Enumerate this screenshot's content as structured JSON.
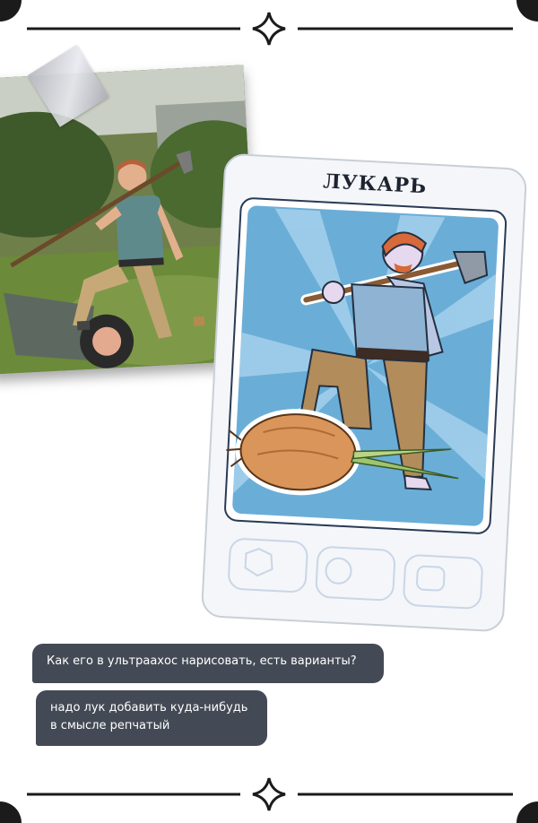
{
  "card": {
    "title": "ЛУКАРЬ"
  },
  "chat": {
    "messages": [
      {
        "lines": [
          "Как его в ультраахос нарисовать, есть варианты?"
        ]
      },
      {
        "lines": [
          "надо лук добавить куда-нибудь",
          "в смысле репчатый"
        ]
      }
    ]
  },
  "colors": {
    "frame": "#1b1b1b",
    "bubble": "#444a55",
    "card_sky": "#6aaed8",
    "card_frame": "#f2f5f8"
  },
  "icons": [
    "four-point-star-icon",
    "onion-icon",
    "shovel-icon"
  ]
}
